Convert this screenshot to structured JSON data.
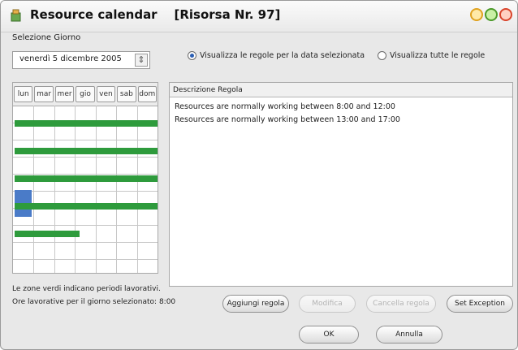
{
  "window": {
    "title": "Resource calendar    [Risorsa Nr. 97]",
    "icon": "resource-calendar-icon",
    "controls": [
      "minimize-icon",
      "maximize-icon",
      "close-icon"
    ]
  },
  "day_selector": {
    "label": "Selezione Giorno",
    "date_value": "venerdì   5 dicembre 2005"
  },
  "calendar": {
    "weekdays": [
      "lun",
      "mar",
      "mer",
      "gio",
      "ven",
      "sab",
      "dom"
    ],
    "colors": {
      "working": "#2e9b3c",
      "selected": "#4a7bc8"
    }
  },
  "notes": {
    "legend": "Le zone verdi indicano periodi lavorativi.",
    "hours_for_day": "Ore lavorative per il giorno selezionato: 8:00"
  },
  "view_options": {
    "selected_date": "Visualizza le regole per la data selezionata",
    "all_rules": "Visualizza tutte le regole",
    "selected": "selected_date"
  },
  "rules": {
    "header": "Descrizione Regola",
    "items": [
      "Resources are normally working between 8:00 and 12:00",
      "Resources are normally working between 13:00 and 17:00"
    ]
  },
  "buttons": {
    "add_rule": "Aggiungi regola",
    "modify": "Modifica",
    "delete_rule": "Cancella regola",
    "set_exception": "Set Exception",
    "ok": "OK",
    "cancel": "Annulla"
  }
}
